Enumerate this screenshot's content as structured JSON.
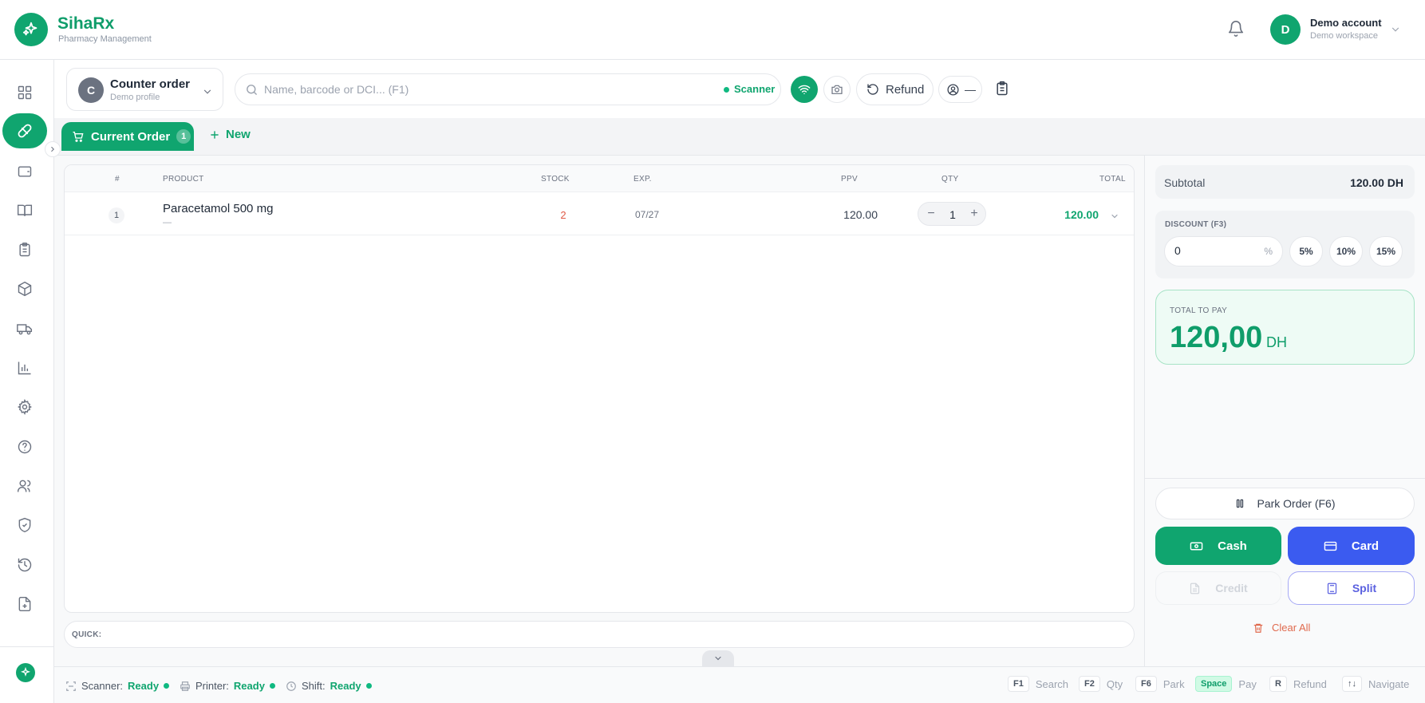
{
  "app": {
    "name": "SihaRx",
    "subtitle": "Pharmacy Management",
    "accent_color": "#10a56f"
  },
  "account": {
    "initial": "D",
    "name": "Demo account",
    "workspace": "Demo workspace"
  },
  "sidebar": {
    "items": [
      {
        "icon": "dashboard-grid-icon"
      },
      {
        "icon": "pill-icon",
        "active": true
      },
      {
        "icon": "wallet-icon"
      },
      {
        "icon": "book-icon"
      },
      {
        "icon": "clipboard-icon"
      },
      {
        "icon": "package-icon"
      },
      {
        "icon": "truck-icon"
      },
      {
        "icon": "bar-chart-icon"
      },
      {
        "icon": "gear-icon"
      },
      {
        "icon": "help-icon"
      },
      {
        "icon": "users-icon"
      },
      {
        "icon": "shield-icon"
      },
      {
        "icon": "history-icon"
      },
      {
        "icon": "file-plus-icon"
      }
    ]
  },
  "order_select": {
    "initial": "C",
    "title": "Counter order",
    "profile": "Demo profile"
  },
  "search": {
    "placeholder": "Name, barcode or DCI... (F1)",
    "scanner_label": "Scanner"
  },
  "toolbar": {
    "refund_label": "Refund",
    "user_label": "—"
  },
  "tabs": {
    "current_label": "Current Order",
    "current_count": "1",
    "new_label": "New"
  },
  "table": {
    "headers": {
      "num": "#",
      "product": "PRODUCT",
      "stock": "STOCK",
      "exp": "EXP.",
      "ppv": "PPV",
      "qty": "QTY",
      "total": "TOTAL"
    },
    "rows": [
      {
        "num": "1",
        "product": "Paracetamol 500 mg",
        "sub": "—",
        "stock": "2",
        "exp": "07/27",
        "ppv": "120.00",
        "qty": "1",
        "total": "120.00"
      }
    ]
  },
  "quick": {
    "label": "QUICK:"
  },
  "status": {
    "scanner_label": "Scanner:",
    "scanner_value": "Ready",
    "printer_label": "Printer:",
    "printer_value": "Ready",
    "shift_label": "Shift:",
    "shift_value": "Ready"
  },
  "shortcuts": [
    {
      "key": "F1",
      "label": "Search"
    },
    {
      "key": "F2",
      "label": "Qty"
    },
    {
      "key": "F6",
      "label": "Park"
    },
    {
      "key": "Space",
      "label": "Pay"
    },
    {
      "key": "R",
      "label": "Refund"
    },
    {
      "key": "↑↓",
      "label": "Navigate"
    }
  ],
  "summary": {
    "subtotal_label": "Subtotal",
    "subtotal_value": "120.00 DH",
    "discount_label": "DISCOUNT (F3)",
    "discount_value": "0",
    "discount_unit": "%",
    "discount_presets": [
      "5%",
      "10%",
      "15%"
    ],
    "total_label": "TOTAL TO PAY",
    "total_amount": "120,00",
    "total_currency": "DH"
  },
  "actions": {
    "park_label": "Park Order (F6)",
    "cash_label": "Cash",
    "card_label": "Card",
    "credit_label": "Credit",
    "split_label": "Split",
    "clear_label": "Clear All",
    "cash_color": "#10a56f",
    "card_color": "#3b5bf0"
  }
}
